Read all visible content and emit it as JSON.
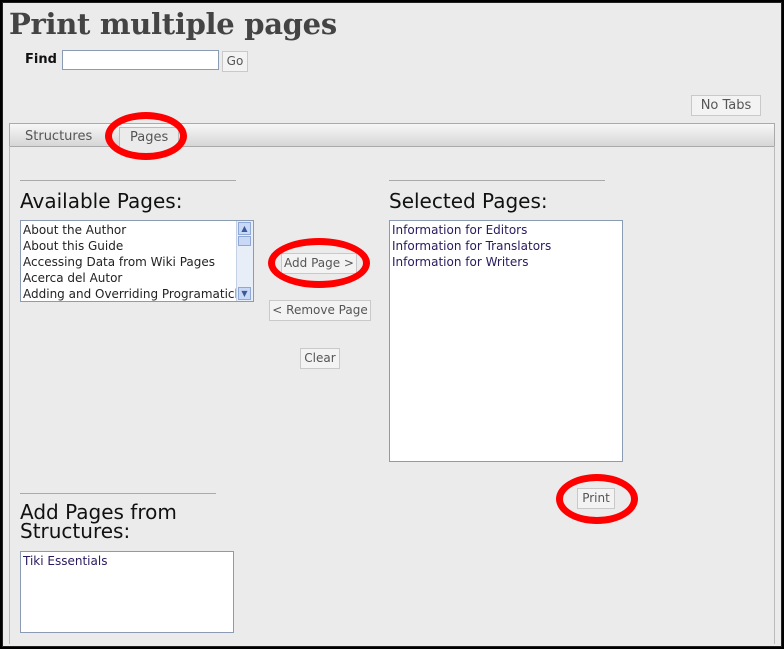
{
  "page": {
    "title": "Print multiple pages"
  },
  "search": {
    "label": "Find",
    "value": "",
    "button": "Go"
  },
  "toolbar": {
    "no_tabs": "No Tabs"
  },
  "tabs": [
    {
      "label": "Structures",
      "active": false
    },
    {
      "label": "Pages",
      "active": true
    }
  ],
  "available": {
    "heading": "Available Pages:",
    "items": [
      "About the Author",
      "About this Guide",
      "Accessing Data from Wiki Pages",
      "Acerca del Autor",
      "Adding and Overriding Programaticlly"
    ]
  },
  "actions": {
    "add": "Add Page >",
    "remove": "< Remove Page",
    "clear": "Clear"
  },
  "selected": {
    "heading": "Selected Pages:",
    "items": [
      "Information for Editors",
      "Information for Translators",
      "Information for Writers"
    ]
  },
  "print": {
    "label": "Print"
  },
  "structures": {
    "heading_line1": "Add Pages from",
    "heading_line2": "Structures:",
    "items": [
      "Tiki Essentials"
    ]
  },
  "colors": {
    "annotation": "#ff0000",
    "background": "#ebebeb"
  }
}
